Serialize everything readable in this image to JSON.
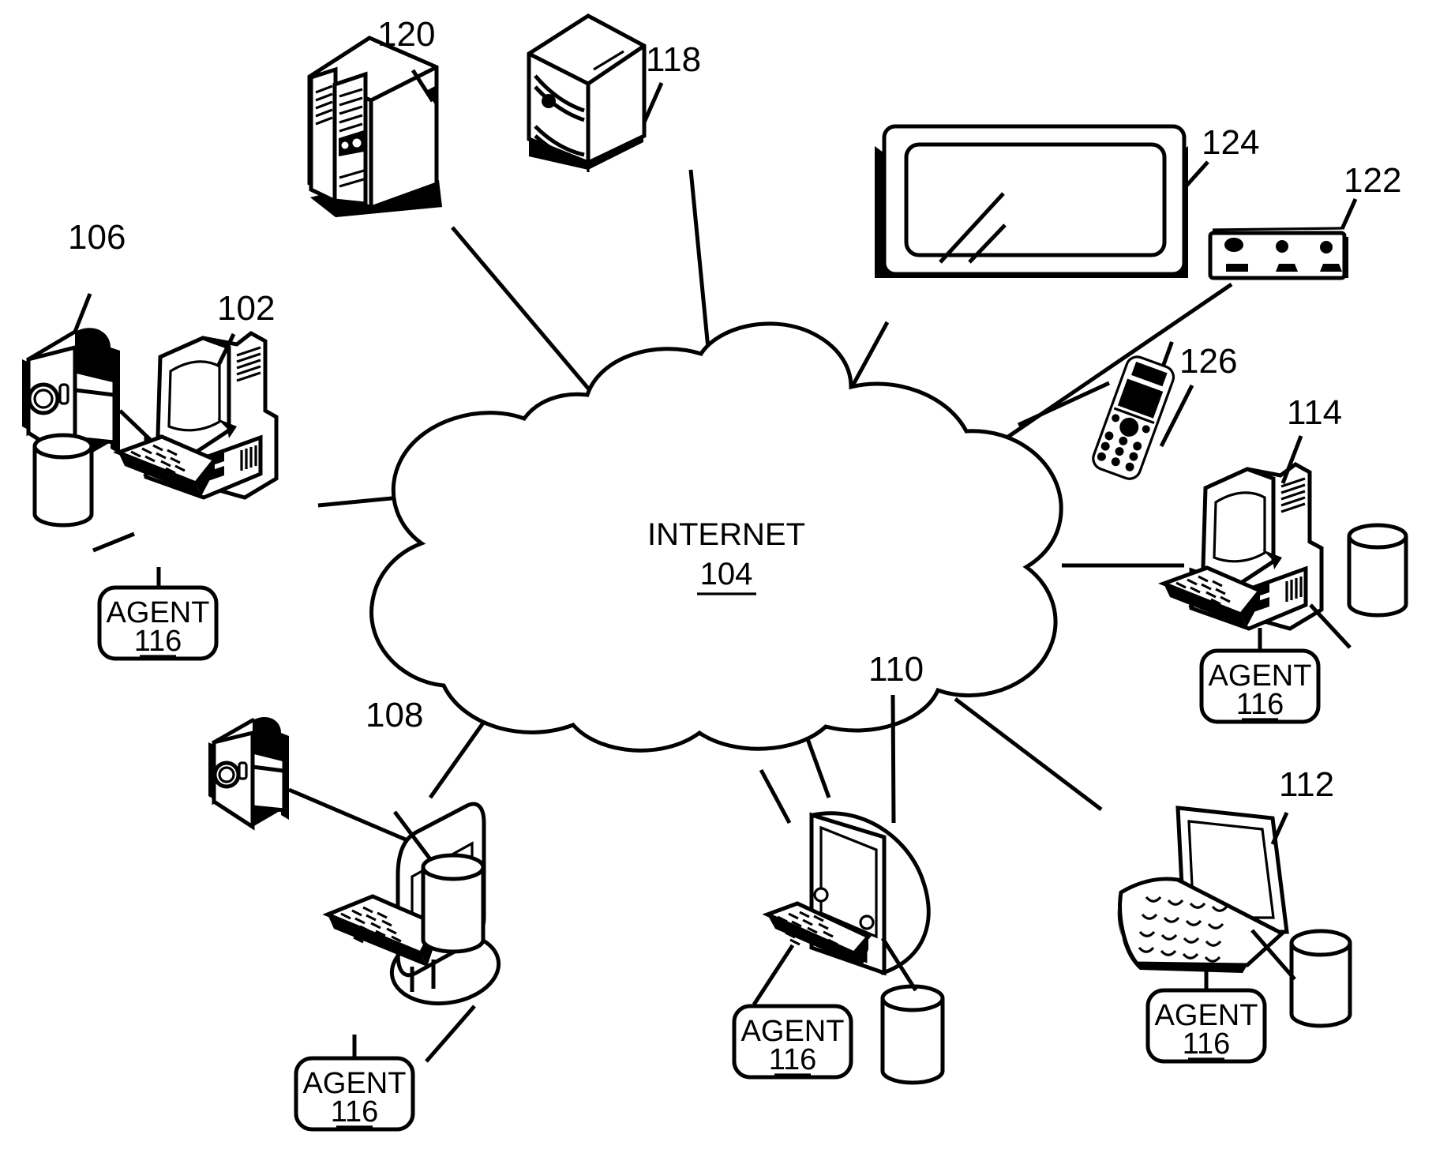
{
  "figure": {
    "type": "patent-network-diagram",
    "background_color": "#ffffff",
    "line_color": "#000000"
  },
  "cloud": {
    "name": "internet-cloud",
    "title": "INTERNET",
    "ref": "104"
  },
  "agent_label": {
    "title": "AGENT",
    "ref": "116"
  },
  "nodes": [
    {
      "id": "mainframe",
      "ref": "120",
      "icon": "mainframe-server-icon"
    },
    {
      "id": "tower-server",
      "ref": "118",
      "icon": "tower-server-icon"
    },
    {
      "id": "flat-panel-tv",
      "ref": "124",
      "icon": "flat-panel-display-icon"
    },
    {
      "id": "set-top-box",
      "ref": "122",
      "icon": "set-top-box-icon"
    },
    {
      "id": "mobile-phone",
      "ref": "126",
      "icon": "mobile-phone-icon"
    },
    {
      "id": "video-camera-left",
      "ref": "106",
      "icon": "video-camera-icon"
    },
    {
      "id": "desktop-computer",
      "ref": "102",
      "icon": "desktop-computer-icon"
    },
    {
      "id": "workstation-right",
      "ref": "114",
      "icon": "desktop-computer-icon"
    },
    {
      "id": "flat-monitor-pc",
      "ref": "108",
      "icon": "flat-panel-monitor-icon"
    },
    {
      "id": "all-in-one-pc",
      "ref": "110",
      "icon": "all-in-one-computer-icon"
    },
    {
      "id": "laptop",
      "ref": "112",
      "icon": "laptop-icon"
    }
  ],
  "agents": [
    {
      "for": "102"
    },
    {
      "for": "114"
    },
    {
      "for": "108"
    },
    {
      "for": "110"
    },
    {
      "for": "112"
    }
  ],
  "databases": [
    {
      "for": "102"
    },
    {
      "for": "114"
    },
    {
      "for": "108"
    },
    {
      "for": "110"
    },
    {
      "for": "112"
    }
  ]
}
